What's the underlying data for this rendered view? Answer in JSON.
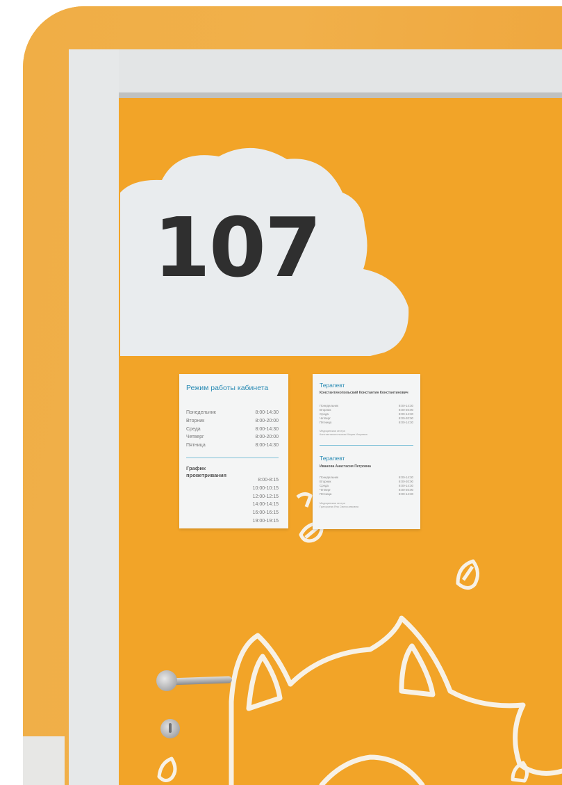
{
  "sign": {
    "room_number": "107"
  },
  "schedule_card": {
    "title": "Режим работы кабинета",
    "days": [
      {
        "day": "Понедельник",
        "hours": "8:00-14:30"
      },
      {
        "day": "Вторник",
        "hours": "8:00-20:00"
      },
      {
        "day": "Среда",
        "hours": "8:00-14:30"
      },
      {
        "day": "Четверг",
        "hours": "8:00-20:00"
      },
      {
        "day": "Пятница",
        "hours": "8:00-14:30"
      }
    ],
    "airing_title": "График проветривания",
    "airing_times": [
      "8:00-8:15",
      "10:00-10:15",
      "12:00-12:15",
      "14:00-14:15",
      "16:00-16:15",
      "19:00-19:15"
    ]
  },
  "doctors_card": {
    "doctor1": {
      "role": "Терапевт",
      "name": "Константинопольский Константин Константинович",
      "days": [
        {
          "day": "Понедельник",
          "hours": "8:00-14:30"
        },
        {
          "day": "Вторник",
          "hours": "8:00-20:00"
        },
        {
          "day": "Среда",
          "hours": "8:00-14:30"
        },
        {
          "day": "Четверг",
          "hours": "8:00-20:00"
        },
        {
          "day": "Пятница",
          "hours": "8:00-14:30"
        }
      ],
      "nurse_label": "Медицинская сестра",
      "nurse_name": "Константинопольская Мария Игоревна"
    },
    "doctor2": {
      "role": "Терапевт",
      "name": "Иванова Анастасия Петровна",
      "days": [
        {
          "day": "Понедельник",
          "hours": "8:00-14:30"
        },
        {
          "day": "Вторник",
          "hours": "8:00-20:00"
        },
        {
          "day": "Среда",
          "hours": "8:00-14:30"
        },
        {
          "day": "Четверг",
          "hours": "8:00-20:00"
        },
        {
          "day": "Пятница",
          "hours": "8:00-14:30"
        }
      ],
      "nurse_label": "Медицинская сестра",
      "nurse_name": "Григорьева Яна Святославовна"
    }
  },
  "colors": {
    "door": "#f2a428",
    "frame": "#e3e5e6",
    "sign": "#e9ecee",
    "number": "#2f2f2f",
    "accent_title": "#2a8bb4"
  }
}
